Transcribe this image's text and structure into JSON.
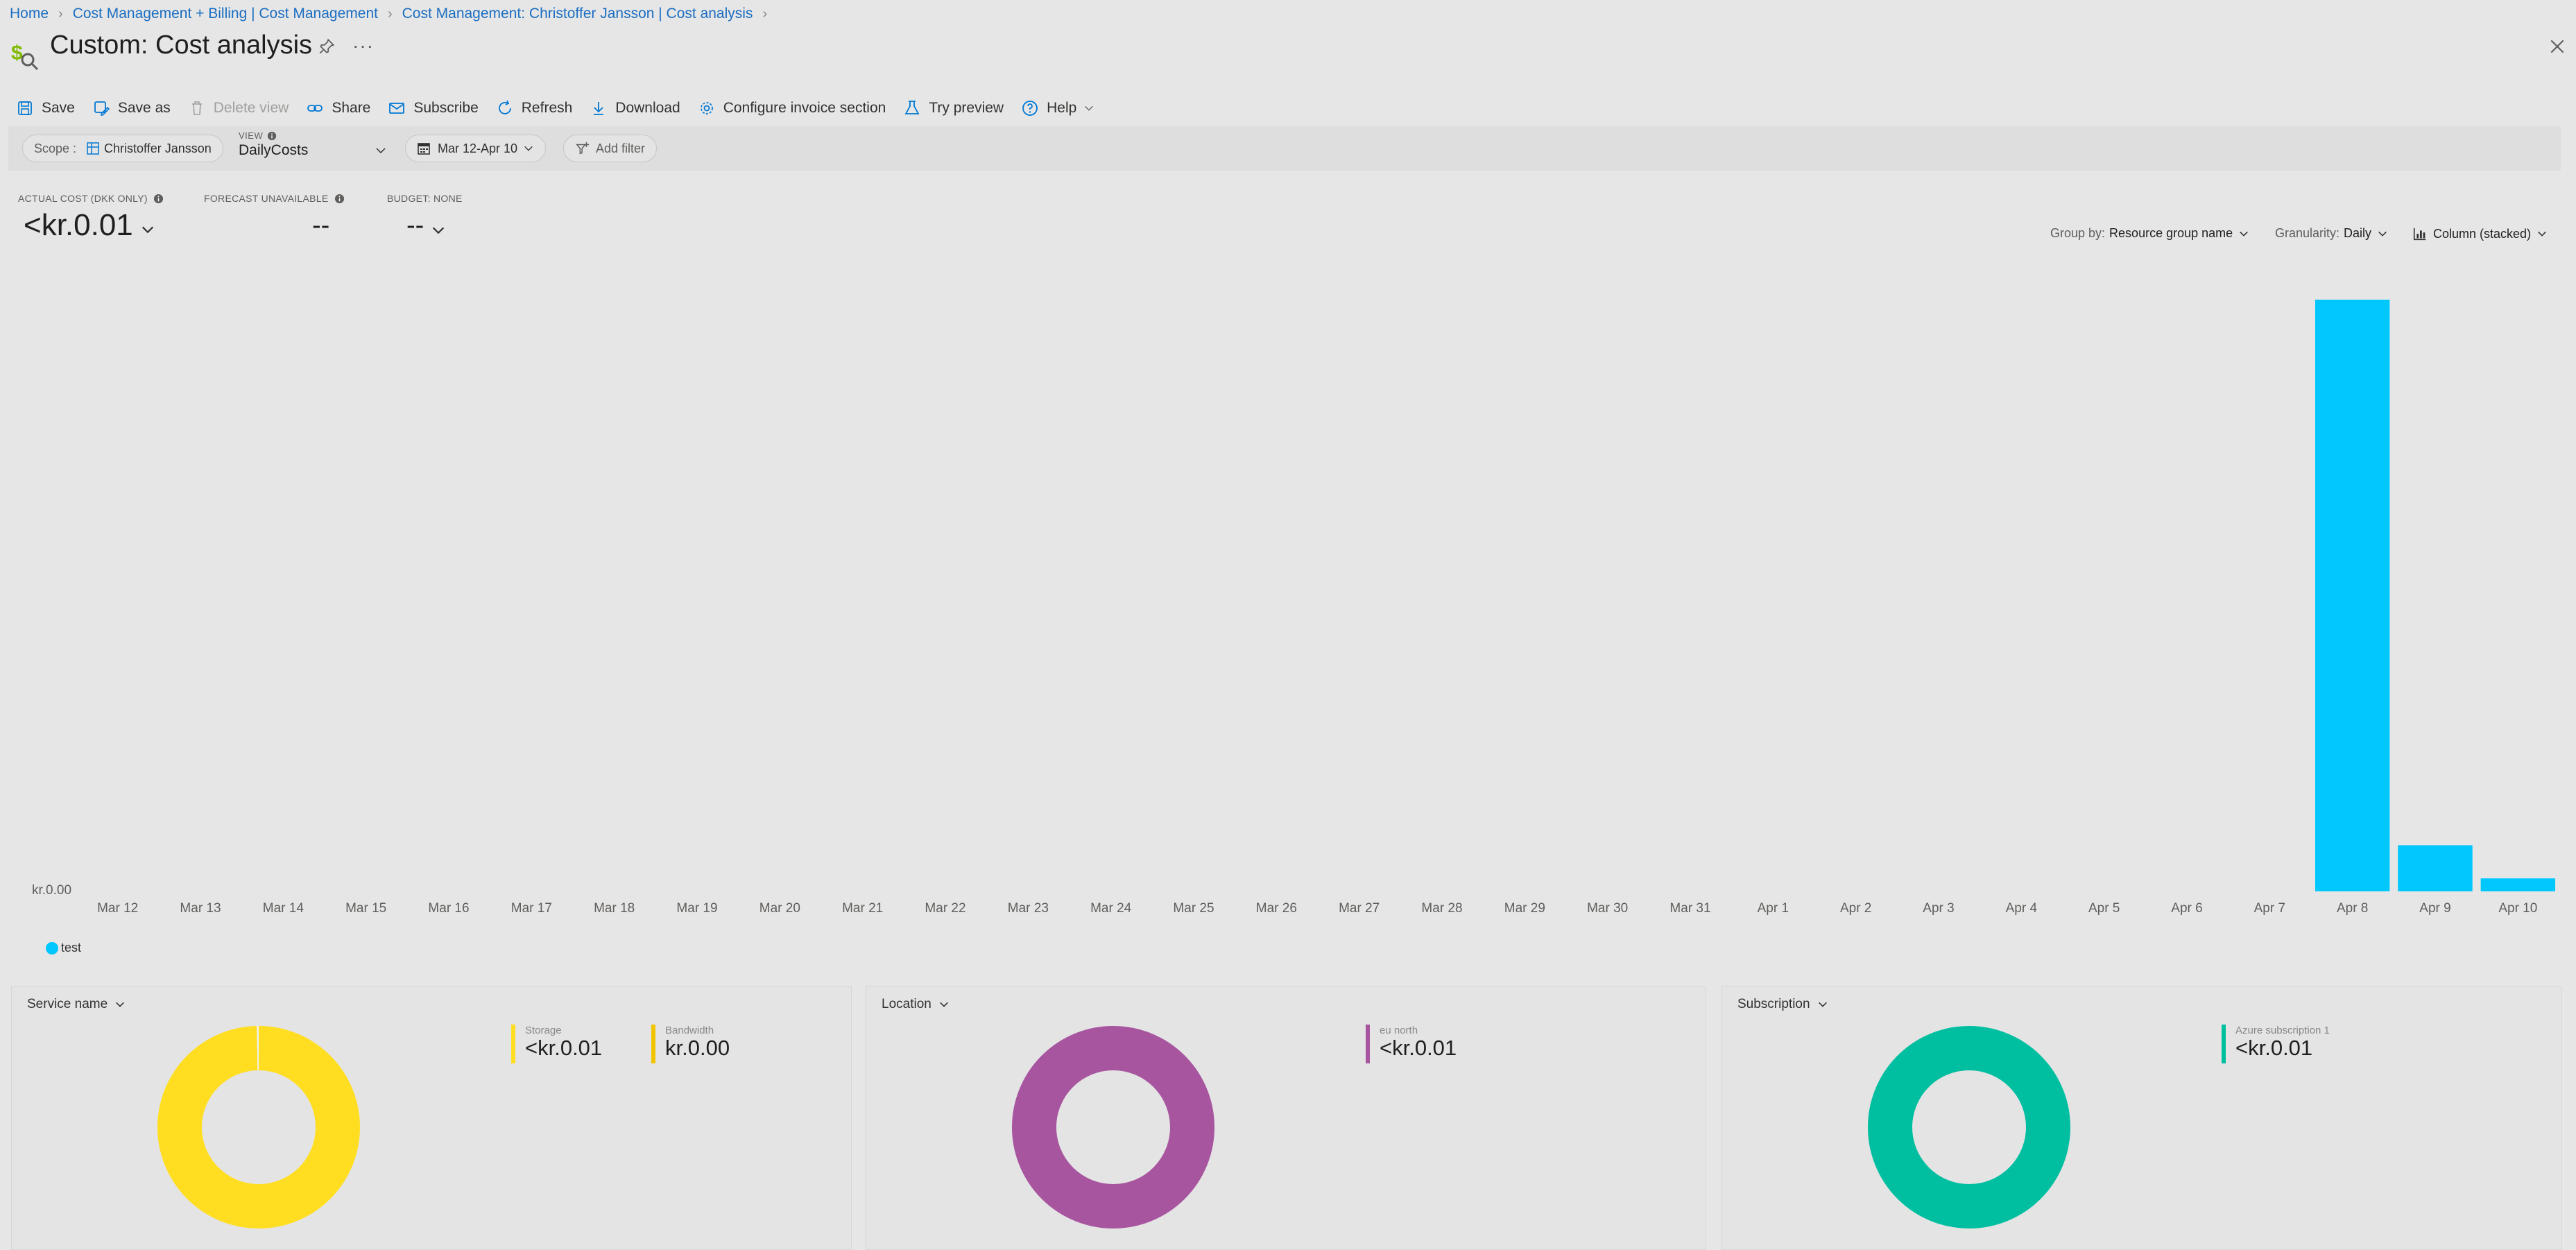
{
  "breadcrumb": [
    {
      "label": "Home"
    },
    {
      "label": "Cost Management + Billing | Cost Management"
    },
    {
      "label": "Cost Management: Christoffer Jansson | Cost analysis"
    }
  ],
  "page": {
    "title": "Custom: Cost analysis",
    "more": "···"
  },
  "toolbar": {
    "save": "Save",
    "save_as": "Save as",
    "delete_view": "Delete view",
    "share": "Share",
    "subscribe": "Subscribe",
    "refresh": "Refresh",
    "download": "Download",
    "configure_invoice": "Configure invoice section",
    "try_preview": "Try preview",
    "help": "Help"
  },
  "filters": {
    "scope_label": "Scope :",
    "scope_value": "Christoffer Jansson",
    "view_label": "VIEW",
    "view_value": "DailyCosts",
    "date_range": "Mar 12-Apr 10",
    "add_filter": "Add filter"
  },
  "kpis": {
    "actual_label": "ACTUAL COST (DKK ONLY)",
    "actual_value": "<kr.0.01",
    "forecast_label": "FORECAST UNAVAILABLE",
    "forecast_value": "--",
    "budget_label": "BUDGET: NONE",
    "budget_value": "--"
  },
  "chart_controls": {
    "group_label": "Group by:",
    "group_value": "Resource group name",
    "granularity_label": "Granularity:",
    "granularity_value": "Daily",
    "chart_type": "Column (stacked)"
  },
  "chart_data": {
    "type": "bar",
    "stacked": true,
    "categories": [
      "Mar 12",
      "Mar 13",
      "Mar 14",
      "Mar 15",
      "Mar 16",
      "Mar 17",
      "Mar 18",
      "Mar 19",
      "Mar 20",
      "Mar 21",
      "Mar 22",
      "Mar 23",
      "Mar 24",
      "Mar 25",
      "Mar 26",
      "Mar 27",
      "Mar 28",
      "Mar 29",
      "Mar 30",
      "Mar 31",
      "Apr 1",
      "Apr 2",
      "Apr 3",
      "Apr 4",
      "Apr 5",
      "Apr 6",
      "Apr 7",
      "Apr 8",
      "Apr 9",
      "Apr 10"
    ],
    "series": [
      {
        "name": "test",
        "color": "#00c8ff",
        "values": [
          0,
          0,
          0,
          0,
          0,
          0,
          0,
          0,
          0,
          0,
          0,
          0,
          0,
          0,
          0,
          0,
          0,
          0,
          0,
          0,
          0,
          0,
          0,
          0,
          0,
          0,
          0,
          1.0,
          0.078,
          0.022
        ]
      }
    ],
    "ytick_label": "kr.0.00",
    "ylim": [
      0,
      1.0
    ],
    "legend_position": "bottom-left",
    "grid": false
  },
  "panels": [
    {
      "header": "Service name",
      "color_primary": "#ffde21",
      "slices": [
        {
          "value": 0.997,
          "color": "#ffde21"
        },
        {
          "value": 0.003,
          "color": "#f0f0f0"
        }
      ],
      "legend": [
        {
          "name": "Storage",
          "value": "<kr.0.01",
          "color": "#ffde21"
        },
        {
          "name": "Bandwidth",
          "value": "kr.0.00",
          "color": "#f2c400"
        }
      ]
    },
    {
      "header": "Location",
      "slices": [
        {
          "value": 1.0,
          "color": "#a855a0"
        }
      ],
      "legend": [
        {
          "name": "eu north",
          "value": "<kr.0.01",
          "color": "#a855a0"
        }
      ]
    },
    {
      "header": "Subscription",
      "slices": [
        {
          "value": 1.0,
          "color": "#00bfa0"
        }
      ],
      "legend": [
        {
          "name": "Azure subscription 1",
          "value": "<kr.0.01",
          "color": "#00bfa0"
        }
      ]
    }
  ]
}
